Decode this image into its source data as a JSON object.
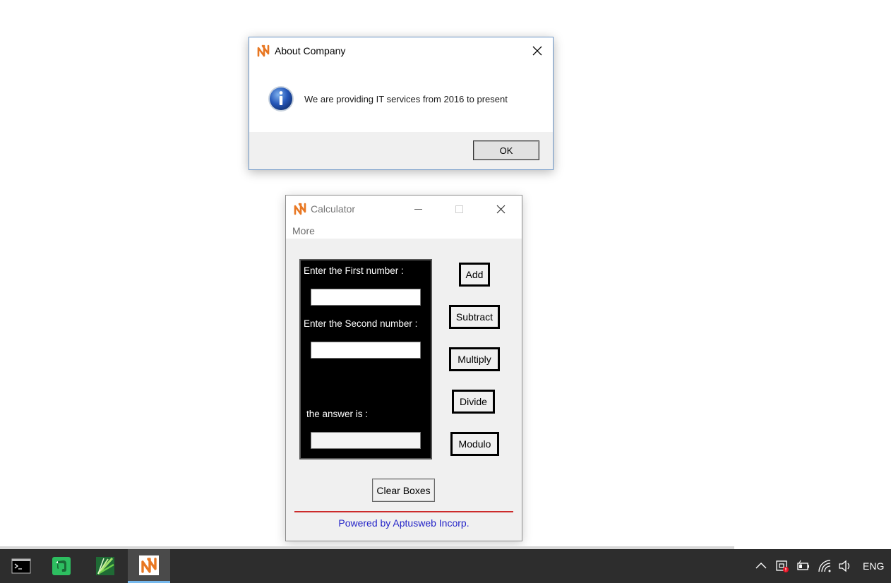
{
  "about_dialog": {
    "title": "About Company",
    "message": "We are providing IT services from 2016 to present",
    "ok_label": "OK"
  },
  "calculator": {
    "title": "Calculator",
    "menu": {
      "more_label": "More"
    },
    "inputs": {
      "first_label": "Enter the First number :",
      "first_value": "",
      "second_label": "Enter the Second number :",
      "second_value": "",
      "answer_label": "the answer is :",
      "answer_value": ""
    },
    "buttons": {
      "add": "Add",
      "subtract": "Subtract",
      "multiply": "Multiply",
      "divide": "Divide",
      "modulo": "Modulo",
      "clear": "Clear Boxes"
    },
    "footer": "Powered by Aptusweb Incorp."
  },
  "taskbar": {
    "apps": [
      {
        "icon": "command-prompt-icon"
      },
      {
        "icon": "evernote-icon"
      },
      {
        "icon": "ide-icon"
      },
      {
        "icon": "calculator-app-icon",
        "active": true
      }
    ],
    "tray": {
      "icons": [
        "chevron-up-icon",
        "security-alert-icon",
        "battery-icon",
        "wifi-icon",
        "volume-icon"
      ],
      "language": "ENG"
    }
  },
  "colors": {
    "brand_orange": "#e87722",
    "footer_text": "#2424c8",
    "divider_red": "#cc2b2b",
    "taskbar": "#2d2d2d"
  }
}
